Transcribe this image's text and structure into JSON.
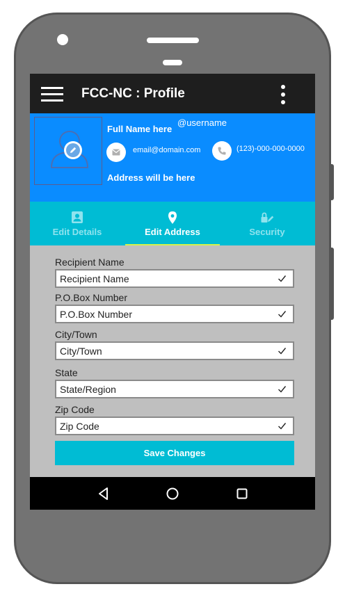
{
  "app": {
    "title": "FCC-NC : Profile",
    "icons": {
      "menu": "hamburger-icon",
      "overflow": "more-vertical-icon"
    }
  },
  "profile": {
    "full_name": "Full Name here",
    "username": "@username",
    "email": "email@domain.com",
    "phone": "(123)-000-000-0000",
    "address": "Address will be here",
    "icons": {
      "avatar": "person-icon",
      "avatar_edit": "pencil-icon",
      "email": "mail-icon",
      "phone": "phone-icon"
    }
  },
  "tabs": [
    {
      "label": "Edit Details",
      "icon": "id-card-icon",
      "active": false
    },
    {
      "label": "Edit Address",
      "icon": "map-pin-icon",
      "active": true
    },
    {
      "label": "Security",
      "icon": "lock-pen-icon",
      "active": false
    }
  ],
  "form": {
    "fields": [
      {
        "label": "Recipient Name",
        "placeholder": "Recipient Name"
      },
      {
        "label": "P.O.Box Number",
        "placeholder": "P.O.Box Number"
      },
      {
        "label": "City/Town",
        "placeholder": "City/Town"
      },
      {
        "label": "State",
        "placeholder": "State/Region"
      },
      {
        "label": "Zip Code",
        "placeholder": "Zip Code"
      }
    ],
    "save_label": "Save Changes"
  },
  "navbar": {
    "icons": [
      "back-icon",
      "home-icon",
      "recents-icon"
    ]
  },
  "colors": {
    "appbar": "#1e1e1e",
    "profile_bg": "#0a8cff",
    "tab_bg": "#00bcd4",
    "tab_indicator": "#d4f24a",
    "form_bg": "#bfbfbf",
    "button": "#00bcd4",
    "phone_body": "#737373"
  }
}
